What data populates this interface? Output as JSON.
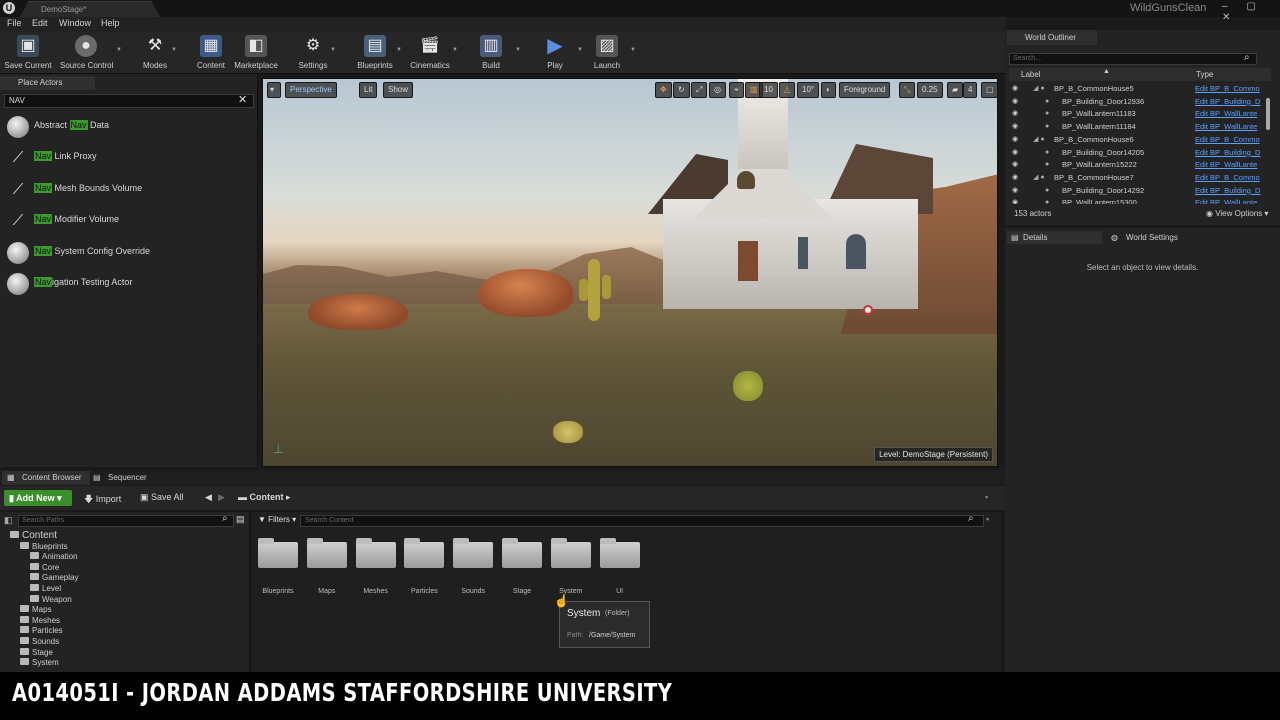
{
  "titlebar": {
    "tab_title": "DemoStage*",
    "project_name": "WildGunsClean",
    "window_controls": "– ▢ ✕"
  },
  "menu": [
    "File",
    "Edit",
    "Window",
    "Help"
  ],
  "toolbar": [
    {
      "label": "Save Current",
      "icon": "save-icon"
    },
    {
      "label": "Source Control",
      "icon": "source-control-icon"
    },
    {
      "label": "Modes",
      "icon": "modes-icon"
    },
    {
      "label": "Content",
      "icon": "content-icon"
    },
    {
      "label": "Marketplace",
      "icon": "marketplace-icon"
    },
    {
      "label": "Settings",
      "icon": "settings-icon"
    },
    {
      "label": "Blueprints",
      "icon": "blueprints-icon"
    },
    {
      "label": "Cinematics",
      "icon": "cinematics-icon"
    },
    {
      "label": "Build",
      "icon": "build-icon"
    },
    {
      "label": "Play",
      "icon": "play-icon"
    },
    {
      "label": "Launch",
      "icon": "launch-icon"
    }
  ],
  "place_actors": {
    "tab": "Place Actors",
    "search_value": "NAV",
    "items": [
      {
        "pre": "Abstract ",
        "hl": "Nav",
        "post": " Data",
        "icon": "sphere"
      },
      {
        "pre": "",
        "hl": "Nav",
        "post": " Link Proxy",
        "icon": "gizmo"
      },
      {
        "pre": "",
        "hl": "Nav",
        "post": " Mesh Bounds Volume",
        "icon": "gizmo"
      },
      {
        "pre": "",
        "hl": "Nav",
        "post": " Modifier Volume",
        "icon": "gizmo"
      },
      {
        "pre": "",
        "hl": "Nav",
        "post": " System Config Override",
        "icon": "sphere"
      },
      {
        "pre": "",
        "hl": "Nav",
        "post": "igation Testing Actor",
        "icon": "sphere"
      }
    ]
  },
  "viewport": {
    "perspective": "Perspective",
    "lit": "Lit",
    "show": "Show",
    "grid_snap": "10",
    "rot_snap": "10°",
    "layer": "Foreground",
    "scale_snap": "0.25",
    "cam_speed": "4",
    "level_label": "Level:  DemoStage (Persistent)"
  },
  "content_browser": {
    "tab": "Content Browser",
    "tab2": "Sequencer",
    "add_new": "Add New",
    "import": "Import",
    "save_all": "Save All",
    "breadcrumb": "Content",
    "search_paths_placeholder": "Search Paths",
    "filters": "Filters",
    "search_content_placeholder": "Search Content",
    "tree": [
      {
        "label": "Content",
        "depth": 0
      },
      {
        "label": "Blueprints",
        "depth": 1
      },
      {
        "label": "Animation",
        "depth": 2
      },
      {
        "label": "Core",
        "depth": 2
      },
      {
        "label": "Gameplay",
        "depth": 2
      },
      {
        "label": "Level",
        "depth": 2
      },
      {
        "label": "Weapon",
        "depth": 2
      },
      {
        "label": "Maps",
        "depth": 1
      },
      {
        "label": "Meshes",
        "depth": 1
      },
      {
        "label": "Particles",
        "depth": 1
      },
      {
        "label": "Sounds",
        "depth": 1
      },
      {
        "label": "Stage",
        "depth": 1
      },
      {
        "label": "System",
        "depth": 1
      }
    ],
    "folders": [
      "Blueprints",
      "Maps",
      "Meshes",
      "Particles",
      "Sounds",
      "Stage",
      "System",
      "UI"
    ],
    "tooltip": {
      "title": "System",
      "type": "(Folder)",
      "path_label": "Path:",
      "path": "/Game/System"
    }
  },
  "outliner": {
    "tab": "World Outliner",
    "search_placeholder": "Search...",
    "col_label": "Label",
    "col_type": "Type",
    "rows": [
      {
        "label": "BP_B_CommonHouse5",
        "type": "Edit BP_B_Commo",
        "indent": 0
      },
      {
        "label": "BP_Building_Door12936",
        "type": "Edit BP_Building_D",
        "indent": 1
      },
      {
        "label": "BP_WallLantern11183",
        "type": "Edit BP_WallLante",
        "indent": 1
      },
      {
        "label": "BP_WallLantern11184",
        "type": "Edit BP_WallLante",
        "indent": 1
      },
      {
        "label": "BP_B_CommonHouse6",
        "type": "Edit BP_B_Commo",
        "indent": 0
      },
      {
        "label": "BP_Building_Door14205",
        "type": "Edit BP_Building_D",
        "indent": 1
      },
      {
        "label": "BP_WallLantern15222",
        "type": "Edit BP_WallLante",
        "indent": 1
      },
      {
        "label": "BP_B_CommonHouse7",
        "type": "Edit BP_B_Commo",
        "indent": 0
      },
      {
        "label": "BP_Building_Door14292",
        "type": "Edit BP_Building_D",
        "indent": 1
      },
      {
        "label": "BP_WallLantern15300",
        "type": "Edit BP_WallLante",
        "indent": 1
      }
    ],
    "actor_count": "153 actors",
    "view_options": "View Options"
  },
  "details": {
    "tab": "Details",
    "tab2": "World Settings",
    "empty_message": "Select an object to view details."
  },
  "caption": "A014051I - JORDAN ADDAMS STAFFORDSHIRE UNIVERSITY"
}
